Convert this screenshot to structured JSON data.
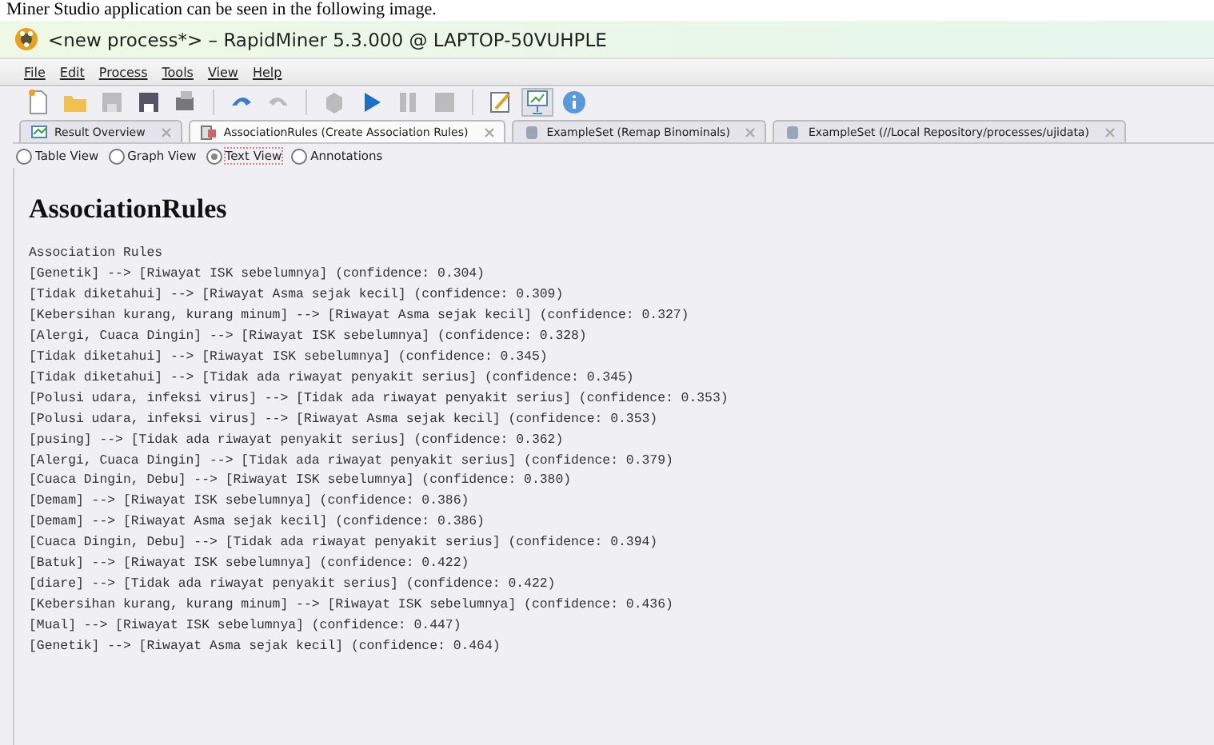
{
  "caption": "Miner Studio application can be seen in the following image.",
  "window": {
    "title": "<new process*> – RapidMiner 5.3.000 @ LAPTOP-50VUHPLE"
  },
  "menu": [
    "File",
    "Edit",
    "Process",
    "Tools",
    "View",
    "Help"
  ],
  "toolbar": [
    {
      "kind": "new"
    },
    {
      "kind": "open"
    },
    {
      "kind": "save",
      "disabled": true
    },
    {
      "kind": "saveas",
      "disabled": false
    },
    {
      "kind": "print",
      "disabled": false
    },
    {
      "kind": "sep"
    },
    {
      "kind": "undo",
      "disabled": false
    },
    {
      "kind": "redo",
      "disabled": true
    },
    {
      "kind": "sep"
    },
    {
      "kind": "operator",
      "disabled": true
    },
    {
      "kind": "run",
      "disabled": false
    },
    {
      "kind": "pause",
      "disabled": true
    },
    {
      "kind": "stop",
      "disabled": true
    },
    {
      "kind": "sep"
    },
    {
      "kind": "design",
      "selected": false
    },
    {
      "kind": "results",
      "selected": true
    },
    {
      "kind": "info"
    }
  ],
  "tabs": [
    {
      "label": "Result Overview",
      "kind": "chart",
      "selected": false
    },
    {
      "label": "AssociationRules (Create Association Rules)",
      "kind": "rules",
      "selected": true
    },
    {
      "label": "ExampleSet (Remap Binominals)",
      "kind": "db",
      "selected": false
    },
    {
      "label": "ExampleSet (//Local Repository/processes/ujidata)",
      "kind": "db",
      "selected": false
    }
  ],
  "views": [
    {
      "label": "Table View",
      "selected": false
    },
    {
      "label": "Graph View",
      "selected": false
    },
    {
      "label": "Text View",
      "selected": true
    },
    {
      "label": "Annotations",
      "selected": false
    }
  ],
  "heading": "AssociationRules",
  "lines": [
    "Association Rules",
    "[Genetik] --> [Riwayat ISK sebelumnya] (confidence: 0.304)",
    "[Tidak diketahui] --> [Riwayat Asma sejak kecil] (confidence: 0.309)",
    "[Kebersihan kurang, kurang minum] --> [Riwayat Asma sejak kecil] (confidence: 0.327)",
    "[Alergi, Cuaca Dingin] --> [Riwayat ISK sebelumnya] (confidence: 0.328)",
    "[Tidak diketahui] --> [Riwayat ISK sebelumnya] (confidence: 0.345)",
    "[Tidak diketahui] --> [Tidak ada riwayat penyakit serius] (confidence: 0.345)",
    "[Polusi udara, infeksi virus] --> [Tidak ada riwayat penyakit serius] (confidence: 0.353)",
    "[Polusi udara, infeksi virus] --> [Riwayat Asma sejak kecil] (confidence: 0.353)",
    "[pusing] --> [Tidak ada riwayat penyakit serius] (confidence: 0.362)",
    "[Alergi, Cuaca Dingin] --> [Tidak ada riwayat penyakit serius] (confidence: 0.379)",
    "[Cuaca Dingin, Debu] --> [Riwayat ISK sebelumnya] (confidence: 0.380)",
    "[Demam] --> [Riwayat ISK sebelumnya] (confidence: 0.386)",
    "[Demam] --> [Riwayat Asma sejak kecil] (confidence: 0.386)",
    "[Cuaca Dingin, Debu] --> [Tidak ada riwayat penyakit serius] (confidence: 0.394)",
    "[Batuk] --> [Riwayat ISK sebelumnya] (confidence: 0.422)",
    "[diare] --> [Tidak ada riwayat penyakit serius] (confidence: 0.422)",
    "[Kebersihan kurang, kurang minum] --> [Riwayat ISK sebelumnya] (confidence: 0.436)",
    "[Mual] --> [Riwayat ISK sebelumnya] (confidence: 0.447)",
    "[Genetik] --> [Riwayat Asma sejak kecil] (confidence: 0.464)"
  ]
}
